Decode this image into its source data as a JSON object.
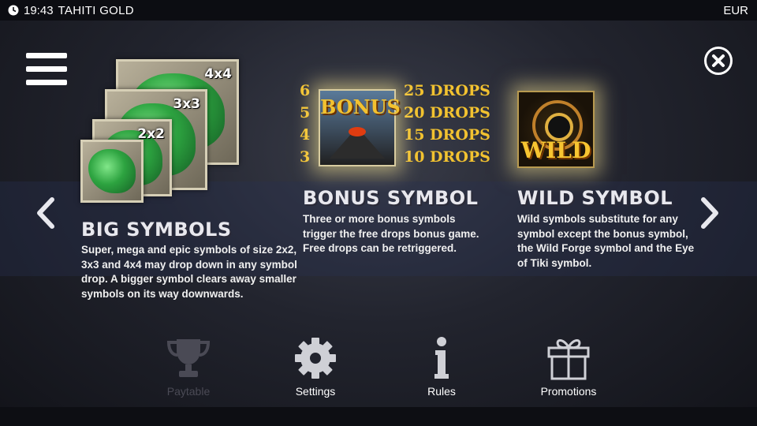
{
  "status_bar": {
    "time": "19:43",
    "game_title": "TAHITI GOLD",
    "currency": "EUR"
  },
  "big_symbols": {
    "tiles": [
      "2x2",
      "3x3",
      "4x4"
    ],
    "heading": "BIG SYMBOLS",
    "description": "Super, mega and epic symbols of size 2x2, 3x3 and 4x4 may drop down in any symbol drop. A bigger symbol clears away smaller symbols on its way downwards."
  },
  "bonus_symbol": {
    "icon_text": "BONUS",
    "payouts": [
      {
        "count": "6",
        "drops": "25 DROPS"
      },
      {
        "count": "5",
        "drops": "20 DROPS"
      },
      {
        "count": "4",
        "drops": "15 DROPS"
      },
      {
        "count": "3",
        "drops": "10 DROPS"
      }
    ],
    "heading": "BONUS SYMBOL",
    "description": "Three or more bonus symbols trigger the free drops bonus game. Free drops can be retriggered."
  },
  "wild_symbol": {
    "icon_text": "WILD",
    "heading": "WILD SYMBOL",
    "description": "Wild symbols substitute for any symbol except the bonus symbol, the Wild Forge symbol and the Eye of Tiki symbol."
  },
  "bottom_nav": [
    {
      "label": "Paytable",
      "icon": "trophy-icon",
      "enabled": false
    },
    {
      "label": "Settings",
      "icon": "gear-icon",
      "enabled": true
    },
    {
      "label": "Rules",
      "icon": "info-icon",
      "enabled": true
    },
    {
      "label": "Promotions",
      "icon": "gift-icon",
      "enabled": true
    }
  ],
  "colors": {
    "gold": "#f2c230",
    "disabled": "#4a4a55",
    "gecko_green": "#22a63a"
  }
}
